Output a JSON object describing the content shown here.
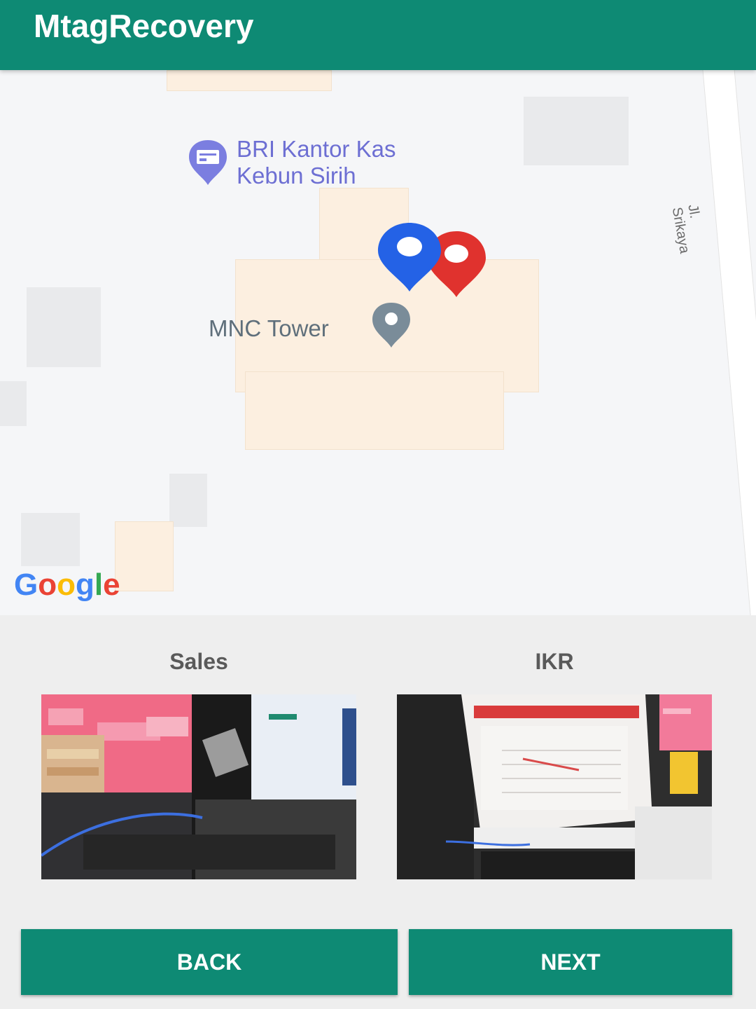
{
  "app_bar": {
    "title": "MtagRecovery",
    "color": "#0e8a74"
  },
  "map": {
    "pois": [
      {
        "name": "BRI Kantor Kas Kebun Sirih",
        "lines": [
          "BRI Kantor Kas",
          "Kebun Sirih"
        ],
        "icon": "bank-icon",
        "color": "#7b7ee0"
      },
      {
        "name": "MNC Tower",
        "icon": "place-icon",
        "color": "#7a8c99"
      }
    ],
    "street": "Jl. Srikaya",
    "markers": [
      {
        "name": "sales-location-marker",
        "color": "#2462e6"
      },
      {
        "name": "ikr-location-marker",
        "color": "#e0322e"
      }
    ],
    "attribution": [
      "G",
      "o",
      "o",
      "g",
      "l",
      "e"
    ]
  },
  "photos": [
    {
      "label": "Sales",
      "icon": "photo-thumbnail"
    },
    {
      "label": "IKR",
      "icon": "photo-thumbnail"
    }
  ],
  "buttons": {
    "back": "BACK",
    "next": "NEXT"
  }
}
